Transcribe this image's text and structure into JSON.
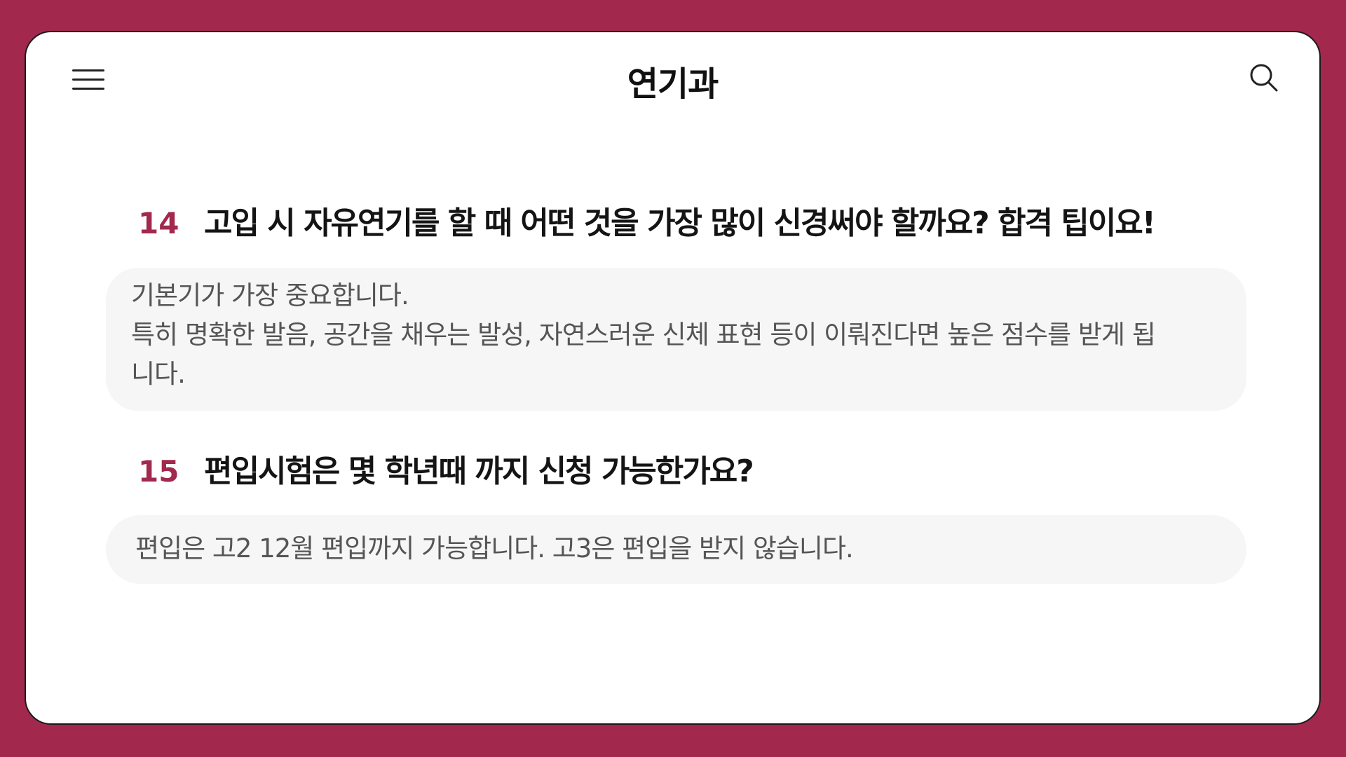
{
  "header": {
    "title": "연기과",
    "menu_icon": "hamburger-menu-icon",
    "search_icon": "search-icon"
  },
  "faq": [
    {
      "number": "14",
      "question": "고입 시 자유연기를 할 때 어떤 것을 가장 많이 신경써야 할까요? 합격 팁이요!",
      "answer_lines": [
        "기본기가 가장 중요합니다.",
        "특히 명확한 발음, 공간을 채우는 발성, 자연스러운 신체 표현 등이 이뤄진다면 높은 점수를 받게 됩",
        "니다."
      ]
    },
    {
      "number": "15",
      "question": "편입시험은 몇 학년때 까지 신청 가능한가요?",
      "answer_lines": [
        "편입은 고2 12월 편입까지 가능합니다. 고3은 편입을 받지 않습니다."
      ]
    }
  ],
  "colors": {
    "background": "#A3284E",
    "accent": "#A3284E",
    "card": "#FFFFFF",
    "answer_bg": "#F6F6F6",
    "answer_text": "#555555",
    "question_text": "#141414"
  }
}
